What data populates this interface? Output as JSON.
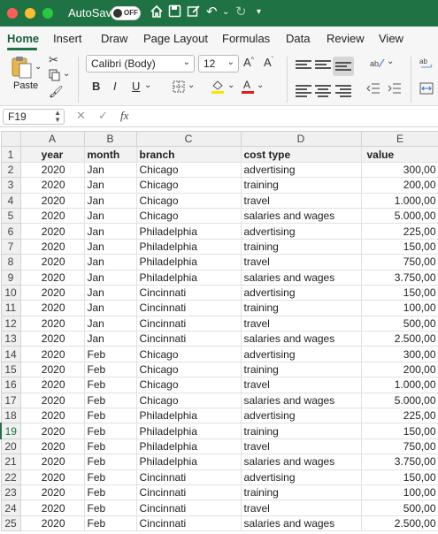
{
  "titlebar": {
    "autosave_label": "AutoSave",
    "toggle_state": "OFF",
    "accent_color": "#1f7244"
  },
  "ribbon_tabs": [
    "Home",
    "Insert",
    "Draw",
    "Page Layout",
    "Formulas",
    "Data",
    "Review",
    "View"
  ],
  "ribbon": {
    "paste_label": "Paste",
    "font_name": "Calibri (Body)",
    "font_size": "12",
    "bold": "B",
    "italic": "I",
    "underline": "U",
    "icons": [
      "paste-icon",
      "cut-icon",
      "copy-icon",
      "format-painter-icon",
      "borders-icon",
      "fill-color-icon",
      "font-color-icon",
      "align-top-icon",
      "align-middle-icon",
      "align-bottom-icon",
      "orientation-icon",
      "wrap-text-icon",
      "align-left-icon",
      "align-center-icon",
      "align-right-icon",
      "decrease-indent-icon",
      "increase-indent-icon",
      "merge-icon"
    ]
  },
  "formula_bar": {
    "cell_ref": "F19",
    "fx": "fx",
    "content": ""
  },
  "sheet": {
    "columns": [
      "A",
      "B",
      "C",
      "D",
      "E"
    ],
    "selected_row": 19,
    "headers": [
      "year",
      "month",
      "branch",
      "cost type",
      "value"
    ],
    "rows": [
      [
        "2020",
        "Jan",
        "Chicago",
        "advertising",
        "300,00"
      ],
      [
        "2020",
        "Jan",
        "Chicago",
        "training",
        "200,00"
      ],
      [
        "2020",
        "Jan",
        "Chicago",
        "travel",
        "1.000,00"
      ],
      [
        "2020",
        "Jan",
        "Chicago",
        "salaries and wages",
        "5.000,00"
      ],
      [
        "2020",
        "Jan",
        "Philadelphia",
        "advertising",
        "225,00"
      ],
      [
        "2020",
        "Jan",
        "Philadelphia",
        "training",
        "150,00"
      ],
      [
        "2020",
        "Jan",
        "Philadelphia",
        "travel",
        "750,00"
      ],
      [
        "2020",
        "Jan",
        "Philadelphia",
        "salaries and wages",
        "3.750,00"
      ],
      [
        "2020",
        "Jan",
        "Cincinnati",
        "advertising",
        "150,00"
      ],
      [
        "2020",
        "Jan",
        "Cincinnati",
        "training",
        "100,00"
      ],
      [
        "2020",
        "Jan",
        "Cincinnati",
        "travel",
        "500,00"
      ],
      [
        "2020",
        "Jan",
        "Cincinnati",
        "salaries and wages",
        "2.500,00"
      ],
      [
        "2020",
        "Feb",
        "Chicago",
        "advertising",
        "300,00"
      ],
      [
        "2020",
        "Feb",
        "Chicago",
        "training",
        "200,00"
      ],
      [
        "2020",
        "Feb",
        "Chicago",
        "travel",
        "1.000,00"
      ],
      [
        "2020",
        "Feb",
        "Chicago",
        "salaries and wages",
        "5.000,00"
      ],
      [
        "2020",
        "Feb",
        "Philadelphia",
        "advertising",
        "225,00"
      ],
      [
        "2020",
        "Feb",
        "Philadelphia",
        "training",
        "150,00"
      ],
      [
        "2020",
        "Feb",
        "Philadelphia",
        "travel",
        "750,00"
      ],
      [
        "2020",
        "Feb",
        "Philadelphia",
        "salaries and wages",
        "3.750,00"
      ],
      [
        "2020",
        "Feb",
        "Cincinnati",
        "advertising",
        "150,00"
      ],
      [
        "2020",
        "Feb",
        "Cincinnati",
        "training",
        "100,00"
      ],
      [
        "2020",
        "Feb",
        "Cincinnati",
        "travel",
        "500,00"
      ],
      [
        "2020",
        "Feb",
        "Cincinnati",
        "salaries and wages",
        "2.500,00"
      ]
    ]
  }
}
